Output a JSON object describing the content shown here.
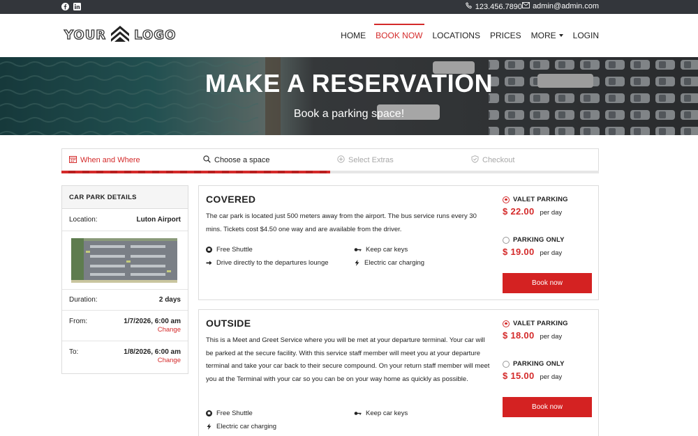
{
  "topbar": {
    "social": [
      "facebook-icon",
      "linkedin-icon"
    ],
    "phone": "123.456.7890",
    "email": "admin@admin.com"
  },
  "header": {
    "logo_left": "YOUR",
    "logo_right": "LOGO",
    "nav": [
      {
        "label": "HOME",
        "active": false
      },
      {
        "label": "BOOK NOW",
        "active": true
      },
      {
        "label": "LOCATIONS",
        "active": false
      },
      {
        "label": "PRICES",
        "active": false
      },
      {
        "label": "MORE",
        "active": false,
        "dropdown": true
      },
      {
        "label": "LOGIN",
        "active": false
      }
    ]
  },
  "hero": {
    "title": "MAKE A RESERVATION",
    "subtitle": "Book a parking space!"
  },
  "steps": [
    {
      "label": "When and Where",
      "icon": "calendar-icon",
      "state": "done"
    },
    {
      "label": "Choose a space",
      "icon": "search-icon",
      "state": "current"
    },
    {
      "label": "Select Extras",
      "icon": "plus-circle-icon",
      "state": "upcoming"
    },
    {
      "label": "Checkout",
      "icon": "shield-check-icon",
      "state": "upcoming"
    }
  ],
  "steps_progress": 0.5,
  "car_park": {
    "heading": "CAR PARK DETAILS",
    "location_label": "Location:",
    "location": "Luton Airport",
    "duration_label": "Duration:",
    "duration": "2 days",
    "from_label": "From:",
    "from": "1/7/2026, 6:00 am",
    "to_label": "To:",
    "to": "1/8/2026, 6:00 am",
    "change_label": "Change"
  },
  "spaces": [
    {
      "title": "COVERED",
      "description": "The car park is located just 500 meters away from the airport. The bus service runs every 30 mins. Tickets cost $4.50 one way and are available from the driver.",
      "features": [
        {
          "label": "Free Shuttle",
          "icon": "shuttle-icon"
        },
        {
          "label": "Keep car keys",
          "icon": "key-icon"
        },
        {
          "label": "Drive directly to the departures lounge",
          "icon": "arrow-right-icon"
        },
        {
          "label": "Electric car charging",
          "icon": "bolt-icon"
        }
      ],
      "options": [
        {
          "name": "VALET PARKING",
          "price": "$ 22.00",
          "unit": "per day",
          "selected": true
        },
        {
          "name": "PARKING ONLY",
          "price": "$ 19.00",
          "unit": "per day",
          "selected": false
        }
      ],
      "button": "Book now"
    },
    {
      "title": "OUTSIDE",
      "description": "This is a Meet and Greet Service where you will be met at your departure terminal. Your car will be parked at the secure facility. With this service staff member will meet you at your departure terminal and take your car back to their secure compound. On your return staff member will meet you at the Terminal with your car so you can be on your way home as quickly as possible.",
      "features": [
        {
          "label": "Free Shuttle",
          "icon": "shuttle-icon"
        },
        {
          "label": "Keep car keys",
          "icon": "key-icon"
        },
        {
          "label": "Electric car charging",
          "icon": "bolt-icon"
        }
      ],
      "options": [
        {
          "name": "VALET PARKING",
          "price": "$ 18.00",
          "unit": "per day",
          "selected": true
        },
        {
          "name": "PARKING ONLY",
          "price": "$ 15.00",
          "unit": "per day",
          "selected": false
        }
      ],
      "button": "Book now"
    }
  ],
  "colors": {
    "accent": "#d42a2a",
    "topbar": "#33363b"
  }
}
